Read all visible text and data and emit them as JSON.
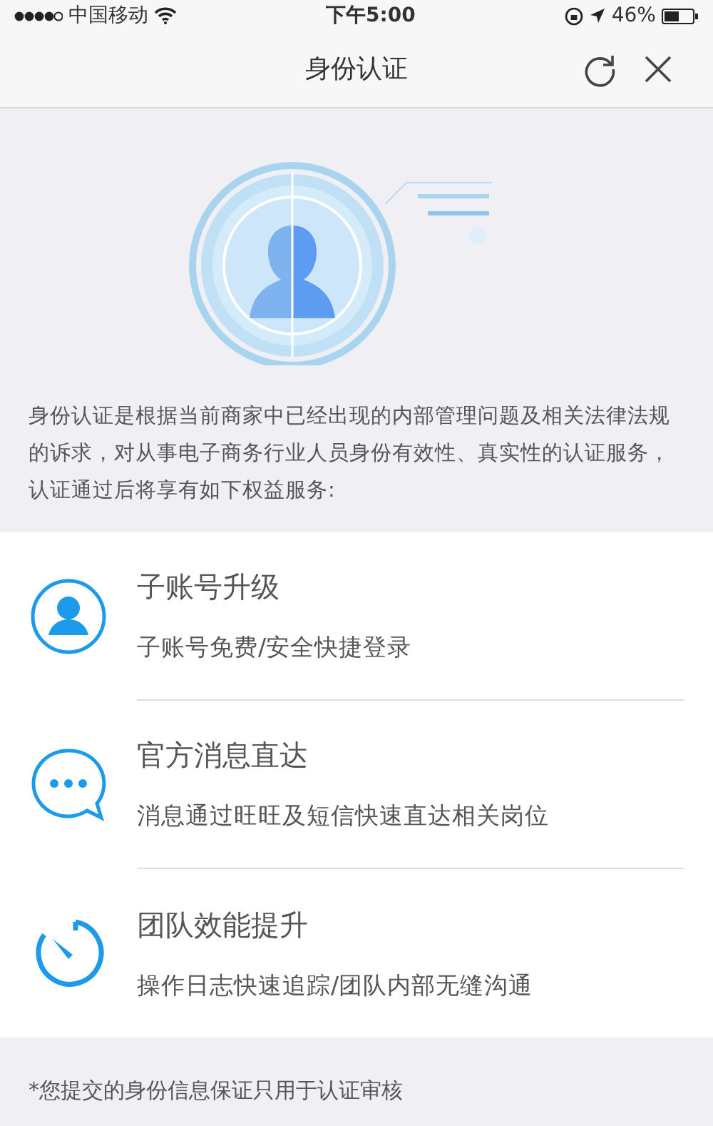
{
  "status_bar": {
    "carrier": "中国移动",
    "time": "下午5:00",
    "battery": "46%"
  },
  "nav": {
    "title": "身份认证"
  },
  "intro": "身份认证是根据当前商家中已经出现的内部管理问题及相关法律法规的诉求，对从事电子商务行业人员身份有效性、真实性的认证服务，认证通过后将享有如下权益服务:",
  "benefits": [
    {
      "kind": "account",
      "title": "子账号升级",
      "subtitle": "子账号免费/安全快捷登录"
    },
    {
      "kind": "message",
      "title": "官方消息直达",
      "subtitle": "消息通过旺旺及短信快速直达相关岗位"
    },
    {
      "kind": "speed",
      "title": "团队效能提升",
      "subtitle": "操作日志快速追踪/团队内部无缝沟通"
    }
  ],
  "footnote": "*您提交的身份信息保证只用于认证审核"
}
